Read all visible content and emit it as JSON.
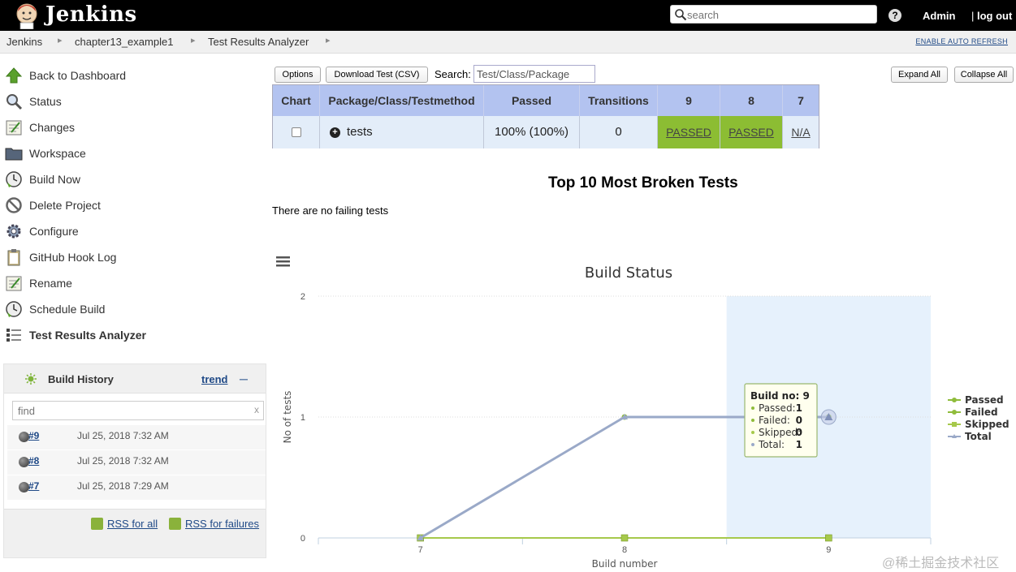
{
  "header": {
    "brand": "Jenkins",
    "search_placeholder": "search",
    "user": "Admin",
    "logout": "log out"
  },
  "breadcrumb": {
    "items": [
      "Jenkins",
      "chapter13_example1",
      "Test Results Analyzer"
    ],
    "auto_refresh": "ENABLE AUTO REFRESH"
  },
  "sidebar": {
    "items": [
      {
        "label": "Back to Dashboard",
        "icon": "up-arrow-icon"
      },
      {
        "label": "Status",
        "icon": "magnifier-icon"
      },
      {
        "label": "Changes",
        "icon": "notepad-icon"
      },
      {
        "label": "Workspace",
        "icon": "folder-icon"
      },
      {
        "label": "Build Now",
        "icon": "clock-icon"
      },
      {
        "label": "Delete Project",
        "icon": "no-entry-icon"
      },
      {
        "label": "Configure",
        "icon": "gear-icon"
      },
      {
        "label": "GitHub Hook Log",
        "icon": "clipboard-icon"
      },
      {
        "label": "Rename",
        "icon": "notepad-icon"
      },
      {
        "label": "Schedule Build",
        "icon": "clock-icon"
      },
      {
        "label": "Test Results Analyzer",
        "icon": "list-icon"
      }
    ]
  },
  "build_history": {
    "title": "Build History",
    "trend": "trend",
    "find_placeholder": "find",
    "builds": [
      {
        "number": "#9",
        "date": "Jul 25, 2018 7:32 AM"
      },
      {
        "number": "#8",
        "date": "Jul 25, 2018 7:32 AM"
      },
      {
        "number": "#7",
        "date": "Jul 25, 2018 7:29 AM"
      }
    ],
    "rss_all": "RSS for all",
    "rss_failures": "RSS for failures"
  },
  "controls": {
    "options": "Options",
    "download": "Download Test (CSV)",
    "search_label": "Search:",
    "search_value": "Test/Class/Package",
    "expand_all": "Expand All",
    "collapse_all": "Collapse All"
  },
  "results_table": {
    "headers": [
      "Chart",
      "Package/Class/Testmethod",
      "Passed",
      "Transitions",
      "9",
      "8",
      "7"
    ],
    "row": {
      "name": "tests",
      "passed": "100% (100%)",
      "transitions": "0",
      "builds": [
        "PASSED",
        "PASSED",
        "N/A"
      ]
    },
    "pass_color": "#8cbd33",
    "header_color": "#b3c3f0"
  },
  "broken": {
    "title": "Top 10 Most Broken Tests",
    "message": "There are no failing tests"
  },
  "chart_data": {
    "type": "line",
    "title": "Build Status",
    "xlabel": "Build number",
    "ylabel": "No of tests",
    "categories": [
      "7",
      "8",
      "9"
    ],
    "ylim": [
      0,
      2
    ],
    "yticks": [
      0,
      1,
      2
    ],
    "series": [
      {
        "name": "Passed",
        "values": [
          0,
          1,
          1
        ],
        "color": "#8fbc3b"
      },
      {
        "name": "Failed",
        "values": [
          0,
          0,
          0
        ],
        "color": "#8fbc3b"
      },
      {
        "name": "Skipped",
        "values": [
          0,
          0,
          0
        ],
        "color": "#a6c94b"
      },
      {
        "name": "Total",
        "values": [
          0,
          1,
          1
        ],
        "color": "#9aa9c8"
      }
    ],
    "highlighted_category": "9",
    "legend": "right",
    "tooltip": {
      "title": "Build no: 9",
      "lines": [
        {
          "label": "Passed:",
          "value": "1"
        },
        {
          "label": "Failed:",
          "value": "0"
        },
        {
          "label": "Skipped:",
          "value": "0"
        },
        {
          "label": "Total:",
          "value": "1"
        }
      ]
    }
  },
  "watermark": "@稀土掘金技术社区"
}
